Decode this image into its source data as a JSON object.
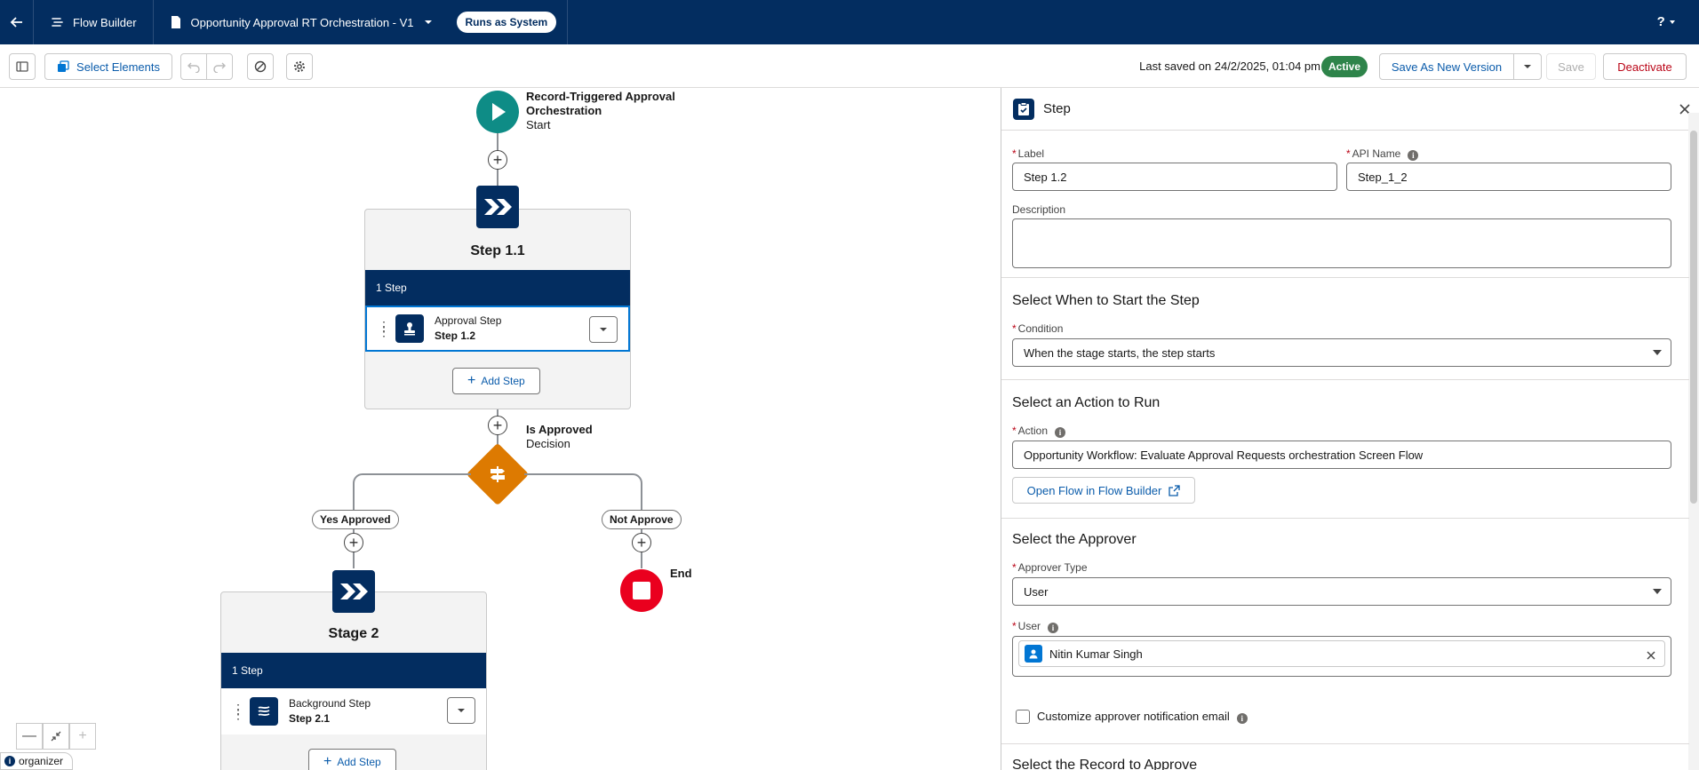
{
  "header": {
    "app_name": "Flow Builder",
    "flow_title": "Opportunity Approval RT Orchestration - V1",
    "runs_as": "Runs as System",
    "help": "?"
  },
  "toolbar": {
    "select_elements": "Select Elements",
    "last_saved": "Last saved on 24/2/2025, 01:04 pm",
    "status": "Active",
    "save_as_new_version": "Save As New Version",
    "save": "Save",
    "deactivate": "Deactivate"
  },
  "canvas": {
    "start": {
      "title_line1": "Record-Triggered Approval",
      "title_line2": "Orchestration",
      "subtitle": "Start"
    },
    "stage1": {
      "title": "Step 1.1",
      "band": "1 Step",
      "step_type": "Approval Step",
      "step_name": "Step 1.2",
      "add_step": "Add Step"
    },
    "decision": {
      "title": "Is Approved",
      "subtitle": "Decision",
      "outcome_yes": "Yes Approved",
      "outcome_no": "Not Approve"
    },
    "end": {
      "label": "End"
    },
    "stage2": {
      "title": "Stage 2",
      "band": "1 Step",
      "step_type": "Background Step",
      "step_name": "Step 2.1",
      "add_step": "Add Step"
    },
    "org_badge": "organizer"
  },
  "panel": {
    "title": "Step",
    "label_field": {
      "label": "Label",
      "value": "Step 1.2"
    },
    "api_name_field": {
      "label": "API Name",
      "value": "Step_1_2"
    },
    "description_field": {
      "label": "Description",
      "value": ""
    },
    "when_section": {
      "title": "Select When to Start the Step",
      "condition_label": "Condition",
      "condition_value": "When the stage starts, the step starts"
    },
    "action_section": {
      "title": "Select an Action to Run",
      "action_label": "Action",
      "action_value": "Opportunity Workflow: Evaluate Approval Requests orchestration Screen Flow",
      "open_flow_button": "Open Flow in Flow Builder"
    },
    "approver_section": {
      "title": "Select the Approver",
      "approver_type_label": "Approver Type",
      "approver_type_value": "User",
      "user_label": "User",
      "user_value": "Nitin Kumar Singh",
      "customize_email_label": "Customize approver notification email",
      "customize_email_checked": false
    },
    "record_section": {
      "title": "Select the Record to Approve"
    }
  },
  "colors": {
    "header_bg": "#032d60",
    "link": "#0b5cab",
    "active_badge": "#2e844a",
    "start_node": "#0e8c86",
    "decision_node": "#dd7a01",
    "end_node": "#ea001e",
    "deactivate_text": "#ba0517"
  }
}
